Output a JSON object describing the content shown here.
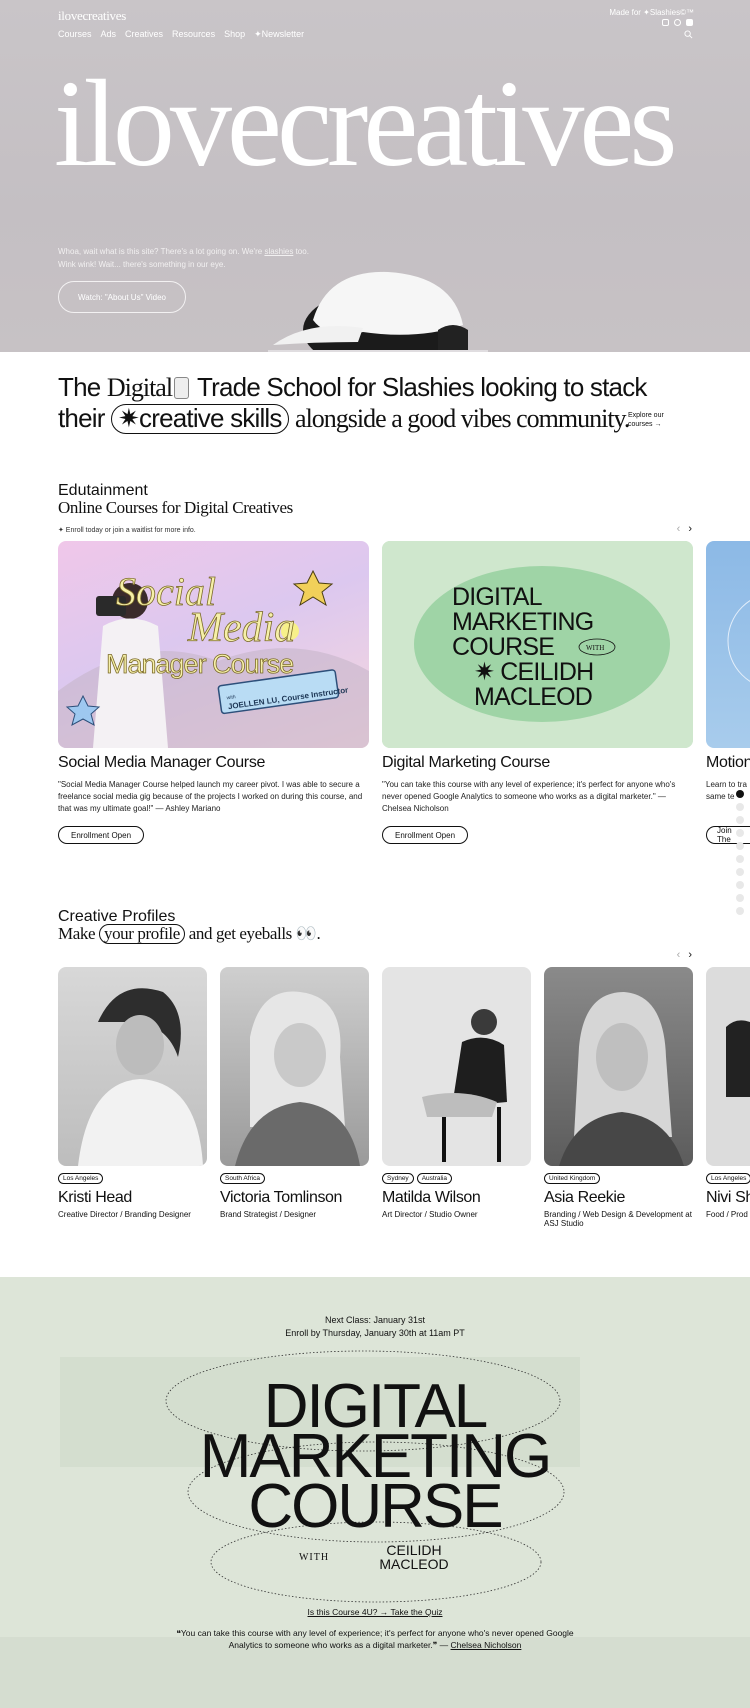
{
  "nav": {
    "logo": "ilovecreatives",
    "links": [
      "Courses",
      "Ads",
      "Creatives",
      "Resources",
      "Shop",
      "✦Newsletter"
    ],
    "made_for": "Made for ✦Slashies©™"
  },
  "hero": {
    "title": "ilovecreatives",
    "intro_a": "Whoa, wait what is this site? There's a lot going on. We're",
    "intro_link": "slashies",
    "intro_b": "too.  Wink wink! Wait... there's something in our eye.",
    "video_button": "Watch: \"About Us\" Video"
  },
  "tagline": {
    "w_the": "The",
    "w_digital": "Digital",
    "w_trade": "Trade School for Slashies looking to stack",
    "w_their": "their",
    "pill": "✷creative skills",
    "w_rest": "alongside a good vibes community.",
    "explore": "Explore our courses →"
  },
  "courses": {
    "kicker": "Edutainment",
    "title": "Online Courses for Digital Creatives",
    "note": "✦ Enroll today or join a waitlist for more info.",
    "prev": "‹",
    "next": "›",
    "items": [
      {
        "name": "Social Media Manager Course",
        "quote": "\"Social Media Manager Course helped launch my career pivot. I was able to secure a freelance social media gig because of the projects I worked on during this course, and that was my ultimate goal!\" — Ashley Mariano",
        "button": "Enrollment Open",
        "art_line1": "Social",
        "art_line2": "Media",
        "art_line3": "Manager Course",
        "art_badge_with": "with",
        "art_badge": "JOELLEN LU, Course Instructor"
      },
      {
        "name": "Digital Marketing Course",
        "quote": "\"You can take this course with any level of experience; it's perfect for anyone who's never opened Google Analytics to someone who works as a digital marketer.\" — Chelsea Nicholson",
        "button": "Enrollment Open",
        "art_line1": "DIGITAL",
        "art_line2": "MARKETING",
        "art_line3": "COURSE",
        "art_with": "WITH",
        "art_line4": "✷  CEILIDH",
        "art_line5": "MACLEOD"
      },
      {
        "name": "Motion",
        "quote": "Learn to tra same te",
        "button": "Join The"
      }
    ],
    "colors": {
      "card1": "#e7c8e8",
      "card2": "#c9e2c9",
      "card3": "#9cc3e8"
    }
  },
  "profiles": {
    "kicker": "Creative Profiles",
    "title_a": "Make",
    "title_pill": "your profile",
    "title_b": "and get eyeballs 👀.",
    "prev": "‹",
    "next": "›",
    "items": [
      {
        "locations": [
          "Los Angeles"
        ],
        "name": "Kristi Head",
        "role": "Creative Director / Branding Designer"
      },
      {
        "locations": [
          "South Africa"
        ],
        "name": "Victoria Tomlinson",
        "role": "Brand Strategist / Designer"
      },
      {
        "locations": [
          "Sydney",
          "Australia"
        ],
        "name": "Matilda Wilson",
        "role": "Art Director / Studio Owner"
      },
      {
        "locations": [
          "United Kingdom"
        ],
        "name": "Asia Reekie",
        "role": "Branding / Web Design & Development at ASJ Studio"
      },
      {
        "locations": [
          "Los Angeles"
        ],
        "name": "Nivi Sh",
        "role": "Food / Prod"
      }
    ]
  },
  "promo": {
    "next_class": "Next Class: January 31st",
    "enroll_by": "Enroll by Thursday, January 30th at 11am PT",
    "line1": "DIGITAL",
    "line2": "MARKETING",
    "line3": "COURSE",
    "with": "WITH",
    "name1": "CEILIDH",
    "name2": "MACLEOD",
    "quiz": "Is this Course 4U? → Take the Quiz",
    "quote_a": "❝You can take this course with any level of experience; it's perfect for anyone who's never opened Google",
    "quote_b": "Analytics to someone who works as a digital marketer.❞ —",
    "quote_author": "Chelsea Nicholson",
    "bg": "#dde5d8"
  }
}
